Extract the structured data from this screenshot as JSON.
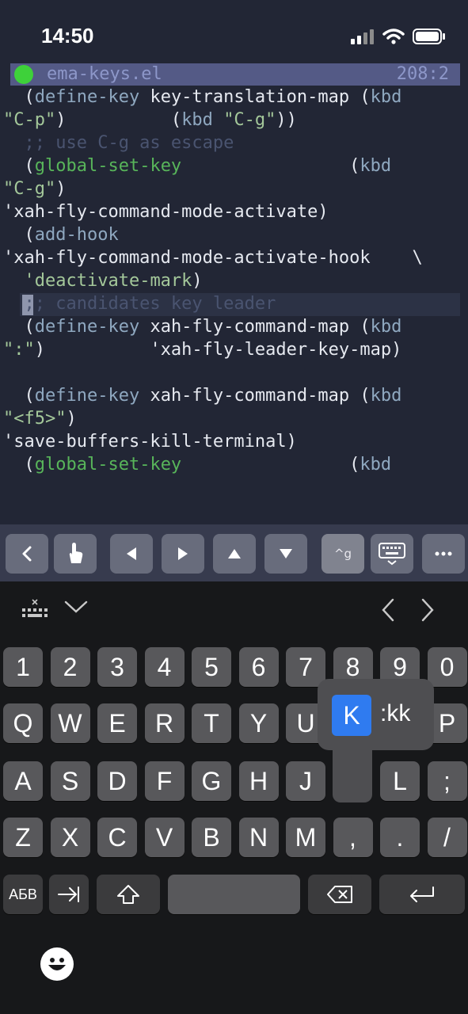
{
  "status": {
    "time": "14:50"
  },
  "editor": {
    "filename": "ema-keys.el",
    "position": "208:2",
    "lines": [
      [
        {
          "t": "  (",
          "c": "default"
        },
        {
          "t": "define-key",
          "c": "kw"
        },
        {
          "t": " key-translation-map (",
          "c": "default"
        },
        {
          "t": "kbd",
          "c": "kw"
        }
      ],
      [
        {
          "t": "\"C-p\"",
          "c": "str"
        },
        {
          "t": ")          (",
          "c": "default"
        },
        {
          "t": "kbd",
          "c": "kw"
        },
        {
          "t": " ",
          "c": "default"
        },
        {
          "t": "\"C-g\"",
          "c": "str"
        },
        {
          "t": "))",
          "c": "default"
        }
      ],
      [
        {
          "t": "  ;; use C-g as escape",
          "c": "com"
        }
      ],
      [
        {
          "t": "  (",
          "c": "default"
        },
        {
          "t": "global-set-key",
          "c": "fn"
        },
        {
          "t": "                (",
          "c": "default"
        },
        {
          "t": "kbd",
          "c": "kw"
        }
      ],
      [
        {
          "t": "\"C-g\"",
          "c": "str"
        },
        {
          "t": ")",
          "c": "default"
        }
      ],
      [
        {
          "t": "'xah-fly-command-mode-activate)",
          "c": "default"
        }
      ],
      [
        {
          "t": "  (",
          "c": "default"
        },
        {
          "t": "add-hook",
          "c": "kw"
        }
      ],
      [
        {
          "t": "'xah-fly-command-mode-activate-hook    \\",
          "c": "default"
        }
      ],
      [
        {
          "t": "  ",
          "c": "default"
        },
        {
          "t": "'deactivate-mark",
          "c": "str"
        },
        {
          "t": ")",
          "c": "default"
        }
      ],
      [
        {
          "t": "  ;; candidates key leader",
          "c": "com"
        }
      ],
      [
        {
          "t": "  (",
          "c": "default"
        },
        {
          "t": "define-key",
          "c": "kw"
        },
        {
          "t": " xah-fly-command-map (",
          "c": "default"
        },
        {
          "t": "kbd",
          "c": "kw"
        }
      ],
      [
        {
          "t": "\":\"",
          "c": "str"
        },
        {
          "t": ")          'xah-fly-leader-key-map)",
          "c": "default"
        }
      ],
      [
        {
          "t": "",
          "c": "default"
        }
      ],
      [
        {
          "t": "  (",
          "c": "default"
        },
        {
          "t": "define-key",
          "c": "kw"
        },
        {
          "t": " xah-fly-command-map (",
          "c": "default"
        },
        {
          "t": "kbd",
          "c": "kw"
        }
      ],
      [
        {
          "t": "\"<f5>\"",
          "c": "str"
        },
        {
          "t": ")",
          "c": "default"
        }
      ],
      [
        {
          "t": "'save-buffers-kill-terminal)",
          "c": "default"
        }
      ],
      [
        {
          "t": "  (",
          "c": "default"
        },
        {
          "t": "global-set-key",
          "c": "fn"
        },
        {
          "t": "                (",
          "c": "default"
        },
        {
          "t": "kbd",
          "c": "kw"
        }
      ]
    ]
  },
  "accessory": {
    "ctrl_g_label": "^g"
  },
  "keyboard": {
    "layout_switch_label": "АБВ",
    "rows": {
      "numbers": [
        "1",
        "2",
        "3",
        "4",
        "5",
        "6",
        "7",
        "8",
        "9",
        "0"
      ],
      "row1": [
        "Q",
        "W",
        "E",
        "R",
        "T",
        "Y",
        "U",
        "I",
        "O",
        "P"
      ],
      "row2": [
        "A",
        "S",
        "D",
        "F",
        "G",
        "H",
        "J",
        "K",
        "L",
        ";"
      ],
      "row3": [
        "Z",
        "X",
        "C",
        "V",
        "B",
        "N",
        "M",
        ",",
        ".",
        "/"
      ]
    },
    "popup": {
      "selected": "K",
      "alternative": ":kk"
    }
  },
  "colors": {
    "background": "#222635",
    "modeline": "#545a86",
    "keyword": "#8fa8c0",
    "function": "#58b55a",
    "string": "#a4c89a",
    "comment": "#4a5470",
    "popup_selected": "#2f7bf0"
  },
  "icons": {
    "status": [
      "signal-icon",
      "wifi-icon",
      "battery-icon"
    ],
    "accessory": [
      "back-icon",
      "touch-icon",
      "left-arrow-icon",
      "right-arrow-icon",
      "up-arrow-icon",
      "down-arrow-icon",
      "ctrl-g-icon",
      "keyboard-icon",
      "more-icon"
    ],
    "keyboard_top": [
      "hide-keyboard-icon",
      "chevron-down-icon",
      "prev-icon",
      "next-icon"
    ],
    "keyboard_bottom": [
      "tab-icon",
      "shift-icon",
      "backspace-icon",
      "return-icon",
      "emoji-icon"
    ]
  }
}
